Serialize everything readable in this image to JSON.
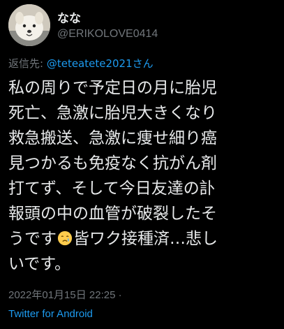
{
  "author": {
    "display_name": "なな",
    "handle": "@ERIKOLOVE0414"
  },
  "reply": {
    "prefix": "返信先: ",
    "mention": "@teteatete2021さん"
  },
  "body": {
    "line1": "私の周りで予定日の月に胎児",
    "line2": "死亡、急激に胎児大きくなり",
    "line3": "救急搬送、急激に痩せ細り癌",
    "line4": "見つかるも免疫なく抗がん剤",
    "line5": "打てず、そして今日友達の訃",
    "line6": "報頭の中の血管が破裂したそ",
    "line7_before_emoji": "うです",
    "line7_after_emoji": "皆ワク接種済…悲し",
    "line8": "いです。",
    "emoji": "crying-face-emoji"
  },
  "meta": {
    "timestamp": "2022年01月15日 22:25 ·",
    "source": "Twitter for Android"
  },
  "colors": {
    "background": "#000000",
    "text": "#e7e9ea",
    "secondary": "#71767b",
    "link": "#1d9bf0"
  }
}
